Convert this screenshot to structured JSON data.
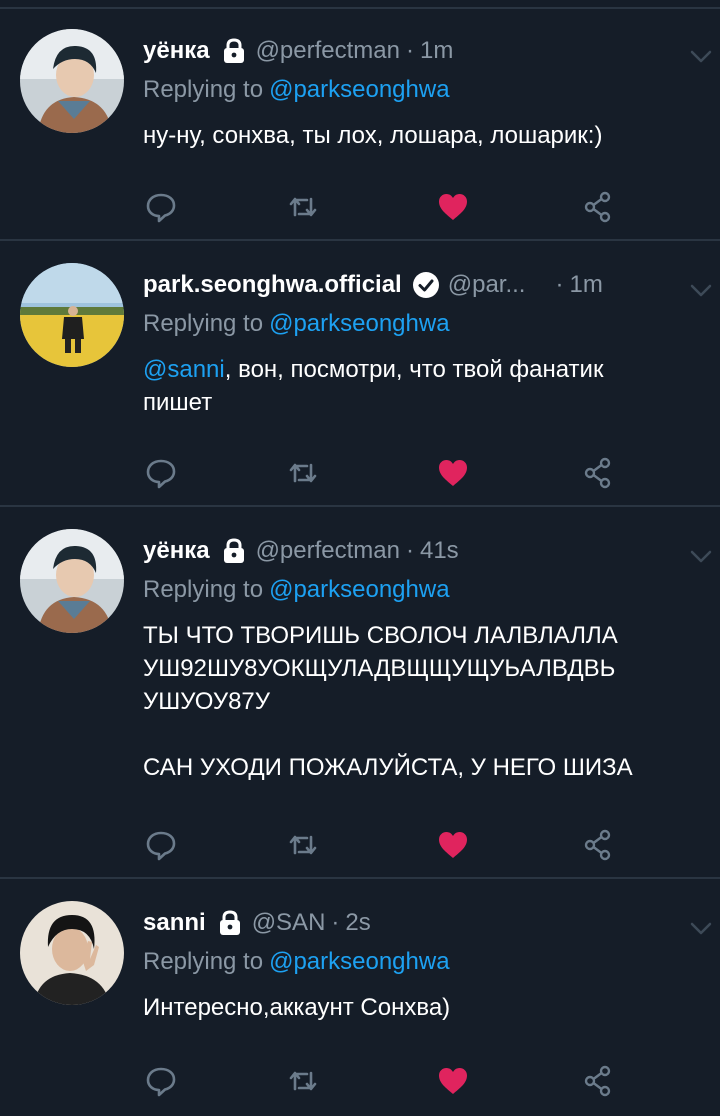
{
  "tweets": [
    {
      "name": "уёнка",
      "handle": "@perfectman",
      "time": "1m",
      "replying_prefix": "Replying to",
      "replying_to": "@parkseonghwa",
      "mention": "",
      "text": "ну-ну, сонхва, ты лох, лошара, лошарик:)",
      "badge": "lock-icon",
      "liked": true
    },
    {
      "name": "park.seonghwa.official",
      "handle": "@par...",
      "time": "1m",
      "replying_prefix": "Replying to",
      "replying_to": "@parkseonghwa",
      "mention": "@sanni",
      "text": ", вон, посмотри, что твой фанатик\nпишет",
      "badge": "verified-icon",
      "liked": true
    },
    {
      "name": "уёнка",
      "handle": "@perfectman",
      "time": "41s",
      "replying_prefix": "Replying to",
      "replying_to": "@parkseonghwa",
      "mention": "",
      "text": "ТЫ ЧТО ТВОРИШЬ СВОЛОЧ ЛАЛВЛАЛЛА\nУШ92ШУ8УОКЩУЛАДВЩЩУЩУЬАЛВДВЬ\nУШУОУ87У\n\nСАН УХОДИ ПОЖАЛУЙСТА, У НЕГО ШИЗА",
      "badge": "lock-icon",
      "liked": true
    },
    {
      "name": "sanni",
      "handle": "@SAN",
      "time": "2s",
      "replying_prefix": "Replying to",
      "replying_to": "@parkseonghwa",
      "mention": "",
      "text": "Интересно,аккаунт Сонхва)",
      "badge": "lock-icon",
      "liked": true
    }
  ],
  "colors": {
    "background": "#151d28",
    "divider": "#2a3542",
    "muted": "#8b98a5",
    "link": "#1da1f2",
    "like": "#e0245e"
  }
}
